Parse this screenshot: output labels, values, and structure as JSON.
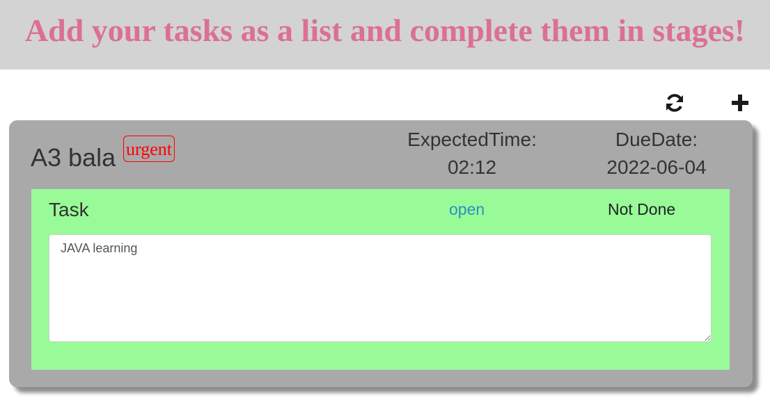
{
  "banner": {
    "title": "Add your tasks as a list and complete them in stages!"
  },
  "toolbar": {
    "refresh_icon": "refresh-icon",
    "add_icon": "plus-icon"
  },
  "card": {
    "name": "A3 bala",
    "priority_badge": "urgent",
    "expected_time_label": "ExpectedTime:",
    "expected_time_value": "02:12",
    "due_date_label": "DueDate:",
    "due_date_value": "2022-06-04",
    "task": {
      "label": "Task",
      "status_link": "open",
      "completion": "Not Done",
      "description": "JAVA learning"
    }
  },
  "colors": {
    "banner_bg": "#d3d3d3",
    "banner_text": "#db7093",
    "card_bg": "#a9a9a9",
    "task_bg": "#98fb98",
    "badge": "#ff0000",
    "link": "#2f8fbf"
  }
}
